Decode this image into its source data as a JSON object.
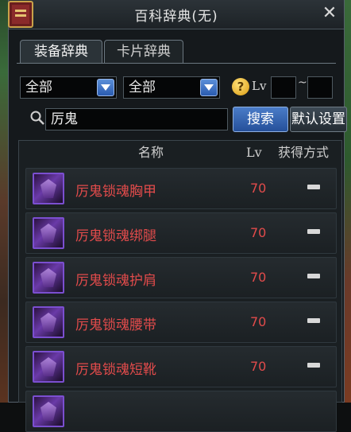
{
  "window": {
    "title": "百科辞典(无)",
    "close_icon": "close-icon"
  },
  "tabs": [
    {
      "label": "装备辞典",
      "active": true
    },
    {
      "label": "卡片辞典",
      "active": false
    }
  ],
  "filters": {
    "select1": "全部",
    "select2": "全部",
    "lv_label": "Lv",
    "lv_min": "",
    "lv_max": "",
    "range_sep": "~"
  },
  "search": {
    "value": "厉鬼",
    "button": "搜索",
    "reset": "默认设置"
  },
  "table": {
    "headers": {
      "name": "名称",
      "lv": "Lv",
      "acquire": "获得方式"
    },
    "rows": [
      {
        "name": "厉鬼锁魂胸甲",
        "lv": "70",
        "acquire": "-"
      },
      {
        "name": "厉鬼锁魂绑腿",
        "lv": "70",
        "acquire": "-"
      },
      {
        "name": "厉鬼锁魂护肩",
        "lv": "70",
        "acquire": "-"
      },
      {
        "name": "厉鬼锁魂腰带",
        "lv": "70",
        "acquire": "-"
      },
      {
        "name": "厉鬼锁魂短靴",
        "lv": "70",
        "acquire": "-"
      }
    ]
  },
  "colors": {
    "item_name": "#e24b4b",
    "rarity_border": "#7b4fd0",
    "button_blue": "#3a6cc0"
  }
}
